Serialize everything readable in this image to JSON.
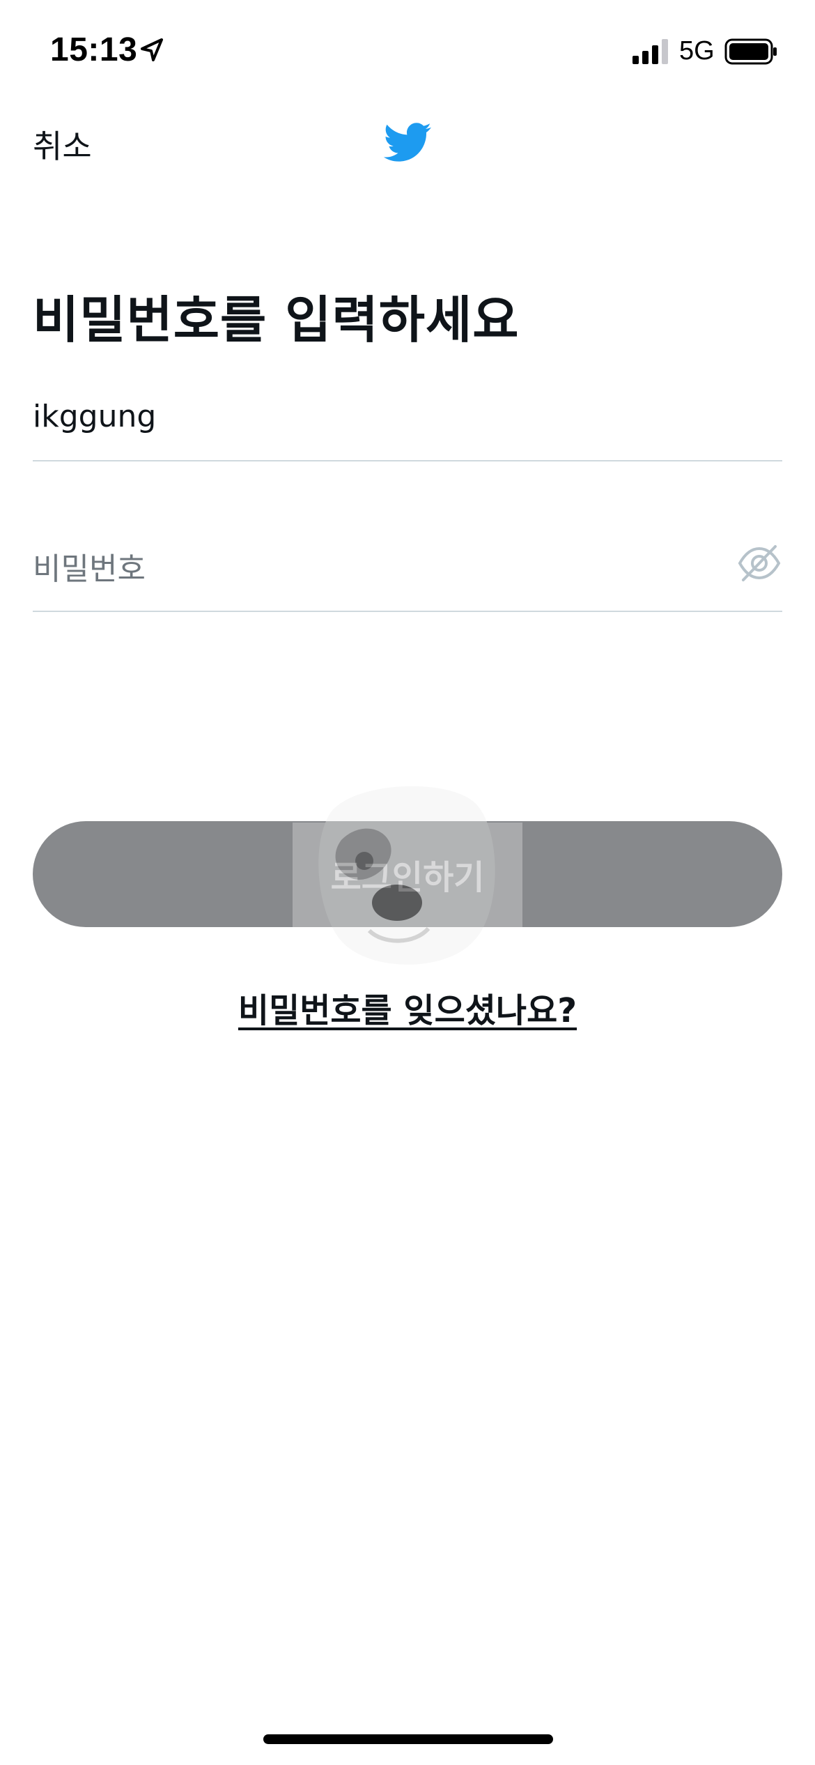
{
  "status_bar": {
    "time": "15:13",
    "network": "5G",
    "location_icon": "location-arrow-icon",
    "signal_icon": "cellular-signal-icon",
    "battery_icon": "battery-icon"
  },
  "header": {
    "cancel_label": "취소",
    "logo_icon": "twitter-bird-icon",
    "brand_color": "#1d9bf0"
  },
  "title": "비밀번호를 입력하세요",
  "username_field": {
    "value": "ikggung"
  },
  "password_field": {
    "placeholder": "비밀번호",
    "toggle_icon": "eye-off-icon"
  },
  "login_button": {
    "label": "로그인하기",
    "color": "#87898c"
  },
  "forgot_password": {
    "label": "비밀번호를 잊으셨나요?"
  }
}
